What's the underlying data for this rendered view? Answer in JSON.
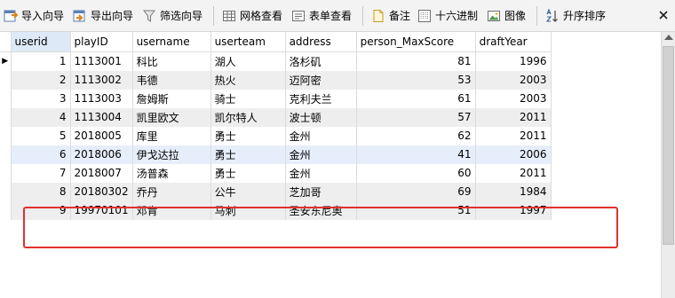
{
  "toolbar": {
    "import_wizard": "导入向导",
    "export_wizard": "导出向导",
    "filter_wizard": "筛选向导",
    "grid_view": "网格查看",
    "form_view": "表单查看",
    "memo": "备注",
    "hex": "十六进制",
    "image": "图像",
    "sort_asc": "升序排序"
  },
  "grid": {
    "columns": [
      "userid",
      "playID",
      "username",
      "userteam",
      "address",
      "person_MaxScore",
      "draftYear"
    ],
    "rows": [
      [
        "1",
        "1113001",
        "科比",
        "湖人",
        "洛杉矶",
        "81",
        "1996"
      ],
      [
        "2",
        "1113002",
        "韦德",
        "热火",
        "迈阿密",
        "53",
        "2003"
      ],
      [
        "3",
        "1113003",
        "詹姆斯",
        "骑士",
        "克利夫兰",
        "61",
        "2003"
      ],
      [
        "4",
        "1113004",
        "凯里欧文",
        "凯尔特人",
        "波士顿",
        "57",
        "2011"
      ],
      [
        "5",
        "2018005",
        "库里",
        "勇士",
        "金州",
        "62",
        "2011"
      ],
      [
        "6",
        "2018006",
        "伊戈达拉",
        "勇士",
        "金州",
        "41",
        "2006"
      ],
      [
        "7",
        "2018007",
        "汤普森",
        "勇士",
        "金州",
        "60",
        "2011"
      ],
      [
        "8",
        "20180302",
        "乔丹",
        "公牛",
        "芝加哥",
        "69",
        "1984"
      ],
      [
        "9",
        "19970101",
        "邓肯",
        "马刺",
        "圣安东尼奥",
        "51",
        "1997"
      ]
    ]
  },
  "colors": {
    "highlight": "#e03030",
    "selected_header": "#dde9f7",
    "selected_row": "#e6eefb",
    "alt_row": "#eeeeee"
  }
}
